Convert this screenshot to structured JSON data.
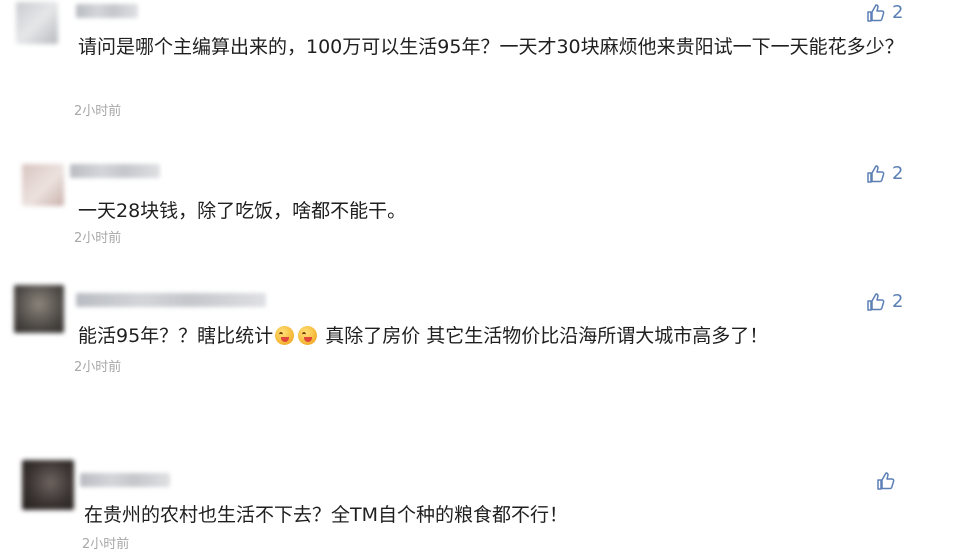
{
  "comments": [
    {
      "text": "请问是哪个主编算出来的，100万可以生活95年？一天才30块麻烦他来贵阳试一下一天能花多少？",
      "time": "2小时前",
      "likes": "2",
      "emojis": []
    },
    {
      "text": "一天28块钱，除了吃饭，啥都不能干。",
      "time": "2小时前",
      "likes": "2",
      "emojis": []
    },
    {
      "text_before": "能活95年？？瞎比统计",
      "text_after": "真除了房价 其它生活物价比沿海所谓大城市高多了！",
      "time": "2小时前",
      "likes": "2",
      "emojis": [
        "laughing-tongue-emoji",
        "laughing-tongue-emoji"
      ]
    },
    {
      "text": "在贵州的农村也生活不下去？全TM自个种的粮食都不行！",
      "time": "2小时前",
      "likes": "",
      "emojis": []
    }
  ],
  "colors": {
    "like_blue": "#5b7fb5",
    "time_gray": "#a8a8a8",
    "text": "#1f1f1f"
  },
  "icons": {
    "like": "thumbs-up-icon"
  }
}
